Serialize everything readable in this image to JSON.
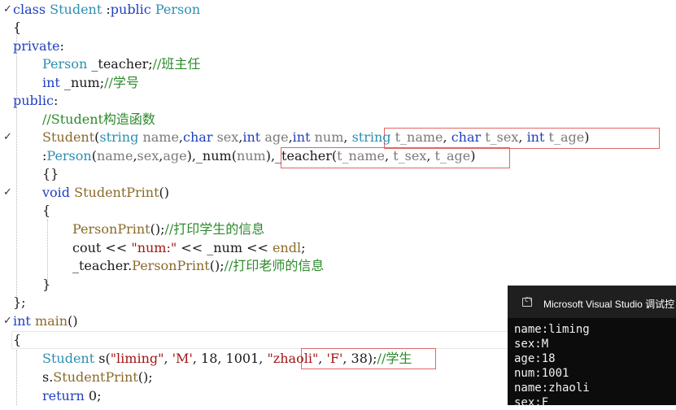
{
  "editor": {
    "lines": [
      {
        "marker": "✓",
        "tokens": [
          {
            "t": "class",
            "c": "kw"
          },
          {
            "t": " "
          },
          {
            "t": "Student",
            "c": "ty"
          },
          {
            "t": " :"
          },
          {
            "t": "public",
            "c": "kw"
          },
          {
            "t": " "
          },
          {
            "t": "Person",
            "c": "ty"
          }
        ]
      },
      {
        "tokens": [
          {
            "t": "{"
          }
        ]
      },
      {
        "tokens": [
          {
            "t": "private",
            "c": "kw"
          },
          {
            "t": ":"
          }
        ]
      },
      {
        "tokens": [
          {
            "t": "Person",
            "c": "ty"
          },
          {
            "t": " _teacher;"
          },
          {
            "t": "//班主任",
            "c": "cm"
          }
        ]
      },
      {
        "tokens": [
          {
            "t": "int",
            "c": "kw"
          },
          {
            "t": " _num;"
          },
          {
            "t": "//学号",
            "c": "cm"
          }
        ]
      },
      {
        "tokens": [
          {
            "t": "public",
            "c": "kw"
          },
          {
            "t": ":"
          }
        ]
      },
      {
        "tokens": [
          {
            "t": "//Student构造函数",
            "c": "cm"
          }
        ]
      },
      {
        "marker": "✓",
        "tokens": [
          {
            "t": "Student",
            "c": "fn"
          },
          {
            "t": "("
          },
          {
            "t": "string",
            "c": "ty"
          },
          {
            "t": " "
          },
          {
            "t": "name",
            "c": "par"
          },
          {
            "t": ","
          },
          {
            "t": "char",
            "c": "kw"
          },
          {
            "t": " "
          },
          {
            "t": "sex",
            "c": "par"
          },
          {
            "t": ","
          },
          {
            "t": "int",
            "c": "kw"
          },
          {
            "t": " "
          },
          {
            "t": "age",
            "c": "par"
          },
          {
            "t": ","
          },
          {
            "t": "int",
            "c": "kw"
          },
          {
            "t": " "
          },
          {
            "t": "num",
            "c": "par"
          },
          {
            "t": ", "
          },
          {
            "t": "string",
            "c": "ty"
          },
          {
            "t": " "
          },
          {
            "t": "t_name",
            "c": "par"
          },
          {
            "t": ", "
          },
          {
            "t": "char",
            "c": "kw"
          },
          {
            "t": " "
          },
          {
            "t": "t_sex",
            "c": "par"
          },
          {
            "t": ", "
          },
          {
            "t": "int",
            "c": "kw"
          },
          {
            "t": " "
          },
          {
            "t": "t_age",
            "c": "par"
          },
          {
            "t": ")"
          }
        ]
      },
      {
        "tokens": [
          {
            "t": ":"
          },
          {
            "t": "Person",
            "c": "ty"
          },
          {
            "t": "("
          },
          {
            "t": "name",
            "c": "par"
          },
          {
            "t": ","
          },
          {
            "t": "sex",
            "c": "par"
          },
          {
            "t": ","
          },
          {
            "t": "age",
            "c": "par"
          },
          {
            "t": "),_num("
          },
          {
            "t": "num",
            "c": "par"
          },
          {
            "t": "),"
          },
          {
            "t": "_teacher("
          },
          {
            "t": "t_name",
            "c": "par"
          },
          {
            "t": ", "
          },
          {
            "t": "t_sex",
            "c": "par"
          },
          {
            "t": ", "
          },
          {
            "t": "t_age",
            "c": "par"
          },
          {
            "t": ")"
          }
        ]
      },
      {
        "tokens": [
          {
            "t": "{}"
          }
        ]
      },
      {
        "marker": "✓",
        "tokens": [
          {
            "t": "void",
            "c": "kw"
          },
          {
            "t": " "
          },
          {
            "t": "StudentPrint",
            "c": "fn"
          },
          {
            "t": "()"
          }
        ]
      },
      {
        "tokens": [
          {
            "t": "{"
          }
        ]
      },
      {
        "tokens": [
          {
            "t": "PersonPrint",
            "c": "fn"
          },
          {
            "t": "();"
          },
          {
            "t": "//打印学生的信息",
            "c": "cm"
          }
        ]
      },
      {
        "tokens": [
          {
            "t": "cout "
          },
          {
            "t": "<<",
            "c": "op"
          },
          {
            "t": " "
          },
          {
            "t": "\"num:\"",
            "c": "st"
          },
          {
            "t": " << _num << "
          },
          {
            "t": "endl",
            "c": "fn"
          },
          {
            "t": ";"
          }
        ]
      },
      {
        "tokens": [
          {
            "t": "_teacher."
          },
          {
            "t": "PersonPrint",
            "c": "fn"
          },
          {
            "t": "();"
          },
          {
            "t": "//打印老师的信息",
            "c": "cm"
          }
        ]
      },
      {
        "tokens": [
          {
            "t": "}"
          }
        ]
      },
      {
        "tokens": [
          {
            "t": "};"
          }
        ]
      },
      {
        "marker": "✓",
        "tokens": [
          {
            "t": "int",
            "c": "kw"
          },
          {
            "t": " "
          },
          {
            "t": "main",
            "c": "fn"
          },
          {
            "t": "()"
          }
        ]
      },
      {
        "tokens": [
          {
            "t": "{"
          }
        ]
      },
      {
        "tokens": [
          {
            "t": "Student",
            "c": "ty"
          },
          {
            "t": " s("
          },
          {
            "t": "\"liming\"",
            "c": "st"
          },
          {
            "t": ", "
          },
          {
            "t": "'M'",
            "c": "st"
          },
          {
            "t": ", 18, 1001, "
          },
          {
            "t": "\"zhaoli\"",
            "c": "st"
          },
          {
            "t": ", "
          },
          {
            "t": "'F'",
            "c": "st"
          },
          {
            "t": ", 38);"
          },
          {
            "t": "//学生",
            "c": "cm"
          }
        ]
      },
      {
        "tokens": [
          {
            "t": "s."
          },
          {
            "t": "StudentPrint",
            "c": "fn"
          },
          {
            "t": "();"
          }
        ]
      },
      {
        "tokens": [
          {
            "t": "return",
            "c": "kw"
          },
          {
            "t": " 0;"
          }
        ]
      }
    ]
  },
  "console": {
    "title": "Microsoft Visual Studio 调试控",
    "icon": "console-window-icon",
    "icon_glyph": "C\\",
    "output": [
      "name:liming",
      "sex:M",
      "age:18",
      "num:1001",
      "name:zhaoli",
      "sex:F"
    ]
  }
}
